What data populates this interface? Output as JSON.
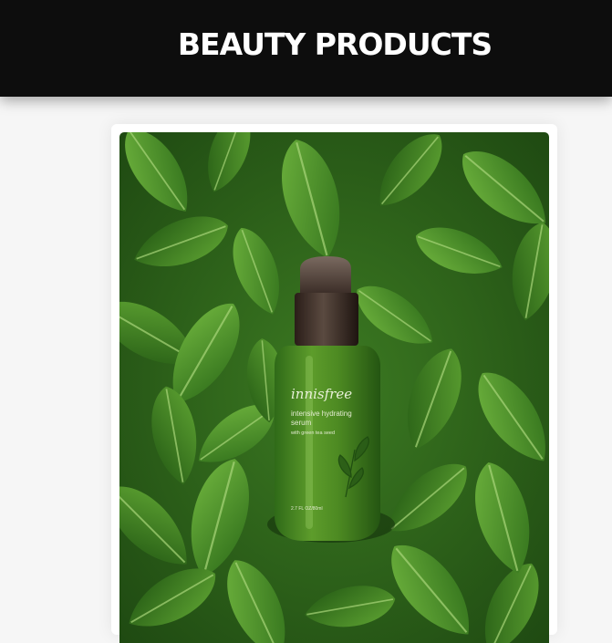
{
  "header": {
    "title": "BEAUTY PRODUCTS"
  },
  "product": {
    "brand": "innisfree",
    "line1": "intensive hydrating",
    "line2": "serum",
    "line3": "with green tea seed",
    "volume": "2.7 FL OZ/80ml"
  }
}
